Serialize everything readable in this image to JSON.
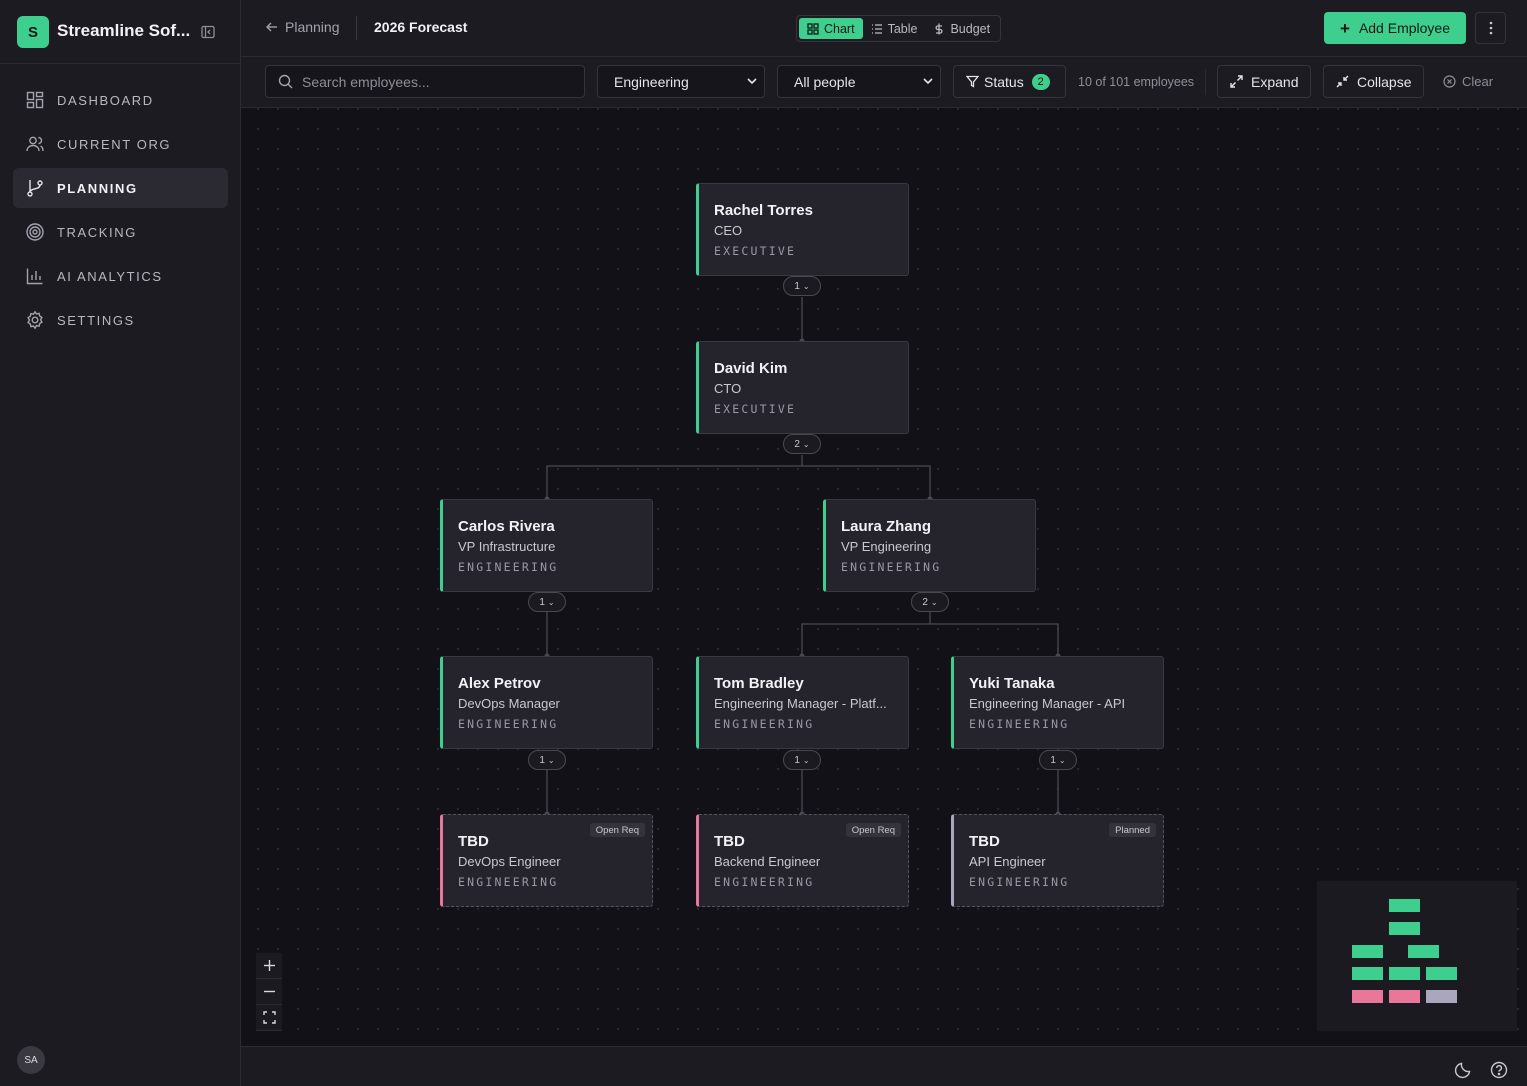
{
  "sidebar": {
    "brand_initial": "S",
    "brand_name": "Streamline Sof...",
    "items": [
      {
        "label": "DASHBOARD",
        "icon": "grid-icon"
      },
      {
        "label": "CURRENT ORG",
        "icon": "users-icon"
      },
      {
        "label": "PLANNING",
        "icon": "branch-icon",
        "active": true
      },
      {
        "label": "TRACKING",
        "icon": "target-icon"
      },
      {
        "label": "AI ANALYTICS",
        "icon": "bar-chart-icon"
      },
      {
        "label": "SETTINGS",
        "icon": "gear-icon"
      }
    ],
    "avatar_initials": "SA"
  },
  "header": {
    "back_label": "Planning",
    "title": "2026 Forecast",
    "views": [
      "Chart",
      "Table",
      "Budget"
    ],
    "active_view": "Chart",
    "add_label": "Add Employee"
  },
  "filters": {
    "search_placeholder": "Search employees...",
    "department": "Engineering",
    "people": "All people",
    "status_label": "Status",
    "status_count": "2",
    "count_text": "10 of 101 employees",
    "expand_label": "Expand",
    "collapse_label": "Collapse",
    "clear_label": "Clear"
  },
  "colors": {
    "accent": "#3ecf8e",
    "open_req": "#e8779a",
    "planned": "#a9a6bd",
    "background": "#121117"
  },
  "org": {
    "nodes": [
      {
        "name": "Rachel Torres",
        "role": "CEO",
        "dept": "EXECUTIVE",
        "children": "1"
      },
      {
        "name": "David Kim",
        "role": "CTO",
        "dept": "EXECUTIVE",
        "children": "2"
      },
      {
        "name": "Carlos Rivera",
        "role": "VP Infrastructure",
        "dept": "ENGINEERING",
        "children": "1"
      },
      {
        "name": "Laura Zhang",
        "role": "VP Engineering",
        "dept": "ENGINEERING",
        "children": "2"
      },
      {
        "name": "Alex Petrov",
        "role": "DevOps Manager",
        "dept": "ENGINEERING",
        "children": "1"
      },
      {
        "name": "Tom Bradley",
        "role": "Engineering Manager - Platf...",
        "dept": "ENGINEERING",
        "children": "1"
      },
      {
        "name": "Yuki Tanaka",
        "role": "Engineering Manager - API",
        "dept": "ENGINEERING",
        "children": "1"
      },
      {
        "name": "TBD",
        "role": "DevOps Engineer",
        "dept": "ENGINEERING",
        "tag": "Open Req"
      },
      {
        "name": "TBD",
        "role": "Backend Engineer",
        "dept": "ENGINEERING",
        "tag": "Open Req"
      },
      {
        "name": "TBD",
        "role": "API Engineer",
        "dept": "ENGINEERING",
        "tag": "Planned"
      }
    ]
  }
}
